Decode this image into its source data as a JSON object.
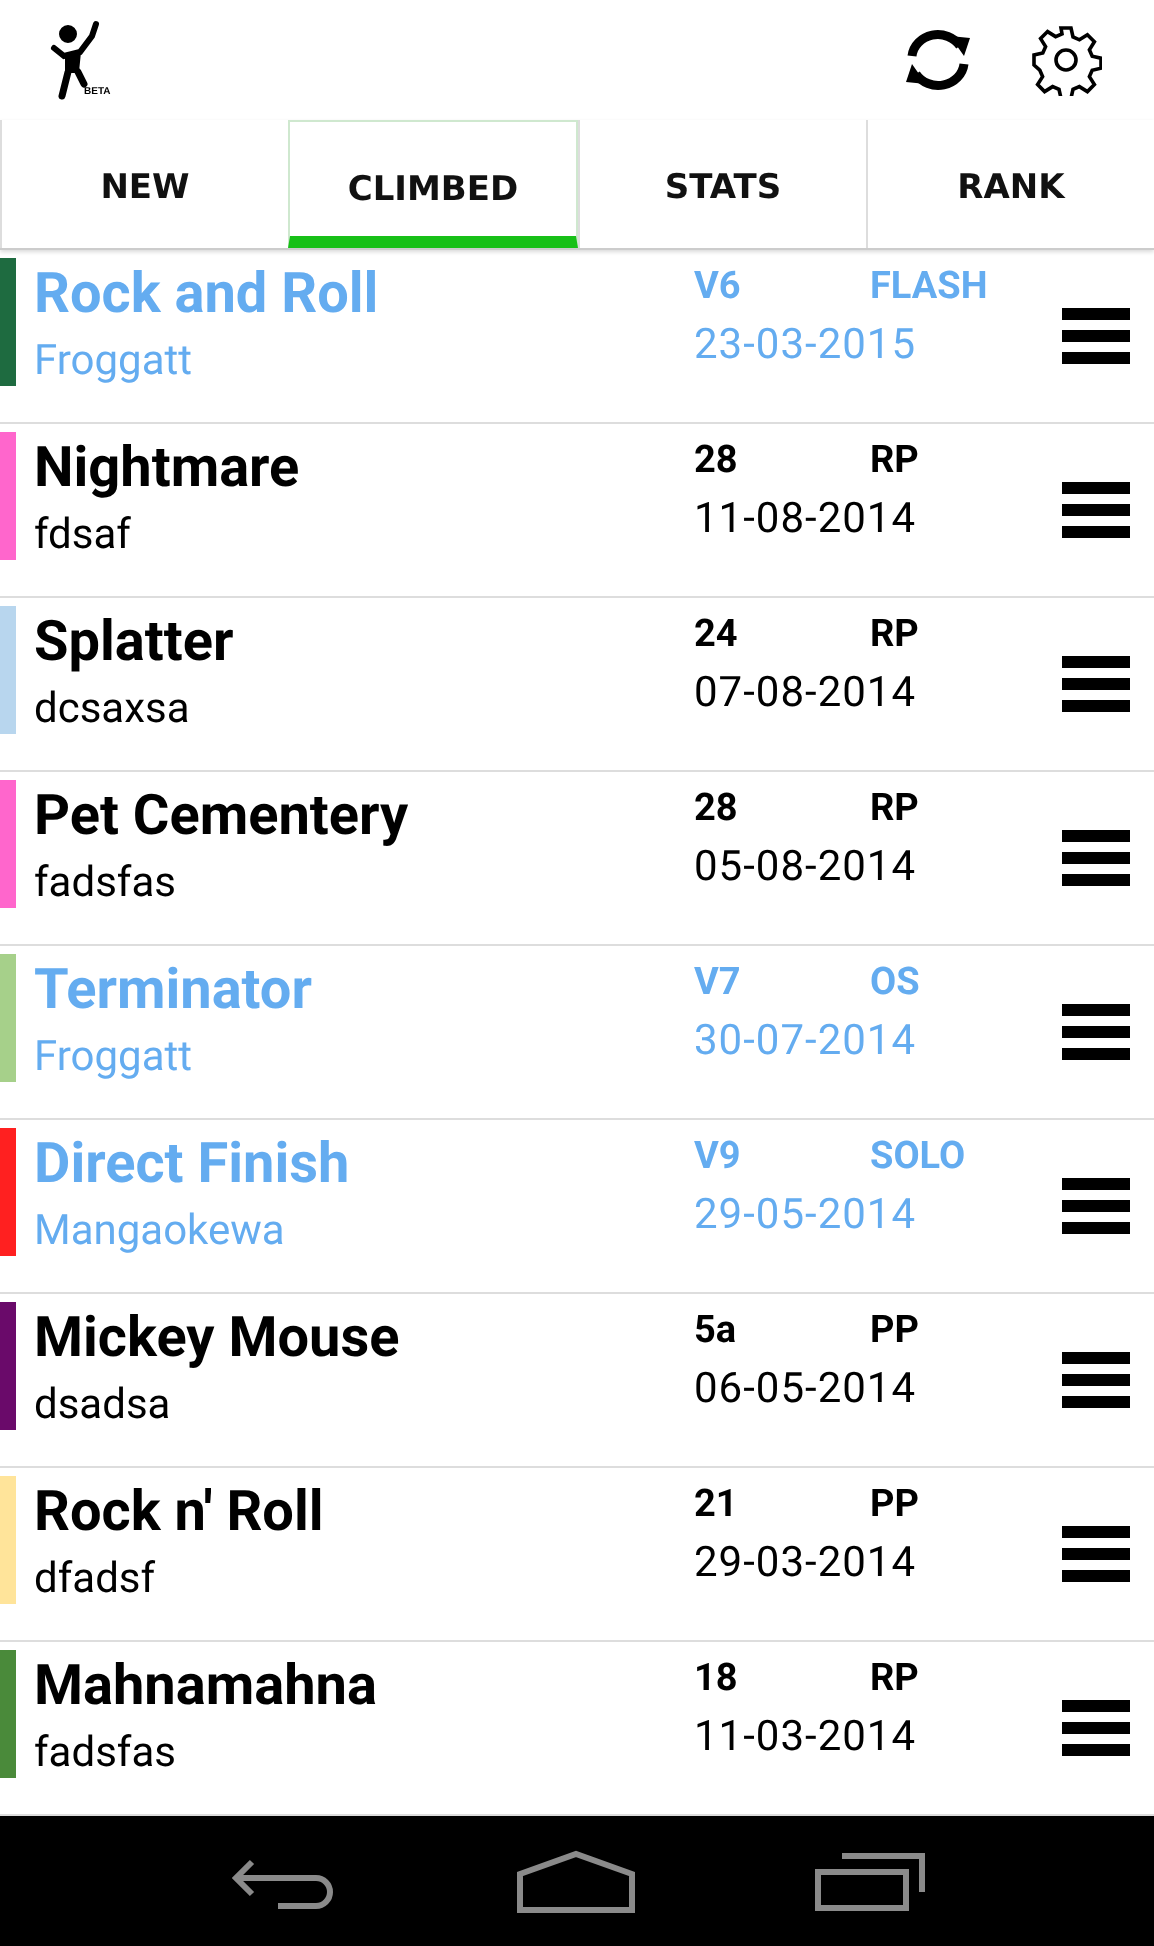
{
  "header": {
    "logo_badge": "BETA"
  },
  "tabs": [
    {
      "label": "NEW",
      "selected": false
    },
    {
      "label": "CLIMBED",
      "selected": true
    },
    {
      "label": "STATS",
      "selected": false
    },
    {
      "label": "RANK",
      "selected": false
    }
  ],
  "climbs": [
    {
      "name": "Rock and Roll",
      "crag": "Froggatt",
      "grade": "V6",
      "style": "FLASH",
      "date": "23-03-2015",
      "kind": "boulder",
      "color": "#1e6b40"
    },
    {
      "name": "Nightmare",
      "crag": "fdsaf",
      "grade": "28",
      "style": "RP",
      "date": "11-08-2014",
      "kind": "route",
      "color": "#ff66cc"
    },
    {
      "name": "Splatter",
      "crag": "dcsaxsa",
      "grade": "24",
      "style": "RP",
      "date": "07-08-2014",
      "kind": "route",
      "color": "#b8d6ee"
    },
    {
      "name": "Pet Cementery",
      "crag": "fadsfas",
      "grade": "28",
      "style": "RP",
      "date": "05-08-2014",
      "kind": "route",
      "color": "#ff66cc"
    },
    {
      "name": "Terminator",
      "crag": "Froggatt",
      "grade": "V7",
      "style": "OS",
      "date": "30-07-2014",
      "kind": "boulder",
      "color": "#a6d08a"
    },
    {
      "name": "Direct Finish",
      "crag": "Mangaokewa",
      "grade": "V9",
      "style": "SOLO",
      "date": "29-05-2014",
      "kind": "boulder",
      "color": "#ff2020"
    },
    {
      "name": "Mickey Mouse",
      "crag": "dsadsa",
      "grade": "5a",
      "style": "PP",
      "date": "06-05-2014",
      "kind": "route",
      "color": "#6a0a6a"
    },
    {
      "name": "Rock n' Roll",
      "crag": "dfadsf",
      "grade": "21",
      "style": "PP",
      "date": "29-03-2014",
      "kind": "route",
      "color": "#ffe49a"
    },
    {
      "name": "Mahnamahna",
      "crag": "fadsfas",
      "grade": "18",
      "style": "RP",
      "date": "11-03-2014",
      "kind": "route",
      "color": "#4a8a3a"
    }
  ]
}
